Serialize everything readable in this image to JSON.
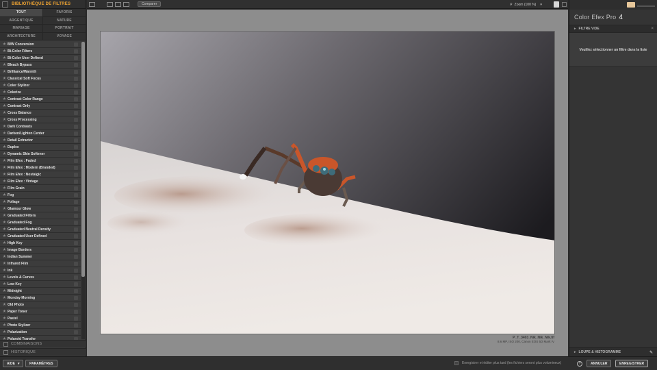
{
  "left_panel": {
    "title": "BIBLIOTHÈQUE DE FILTRES",
    "categories": [
      {
        "label": "TOUT",
        "active": true
      },
      {
        "label": "FAVORIS",
        "active": false
      },
      {
        "label": "ARGENTIQUE",
        "active": false
      },
      {
        "label": "NATURE",
        "active": false
      },
      {
        "label": "MARIAGE",
        "active": false
      },
      {
        "label": "PORTRAIT",
        "active": false
      },
      {
        "label": "ARCHITECTURE",
        "active": false
      },
      {
        "label": "VOYAGE",
        "active": false
      }
    ],
    "filters": [
      "B/W Conversion",
      "Bi-Color Filters",
      "Bi-Color User Defined",
      "Bleach Bypass",
      "Brilliance/Warmth",
      "Classical Soft Focus",
      "Color Stylizer",
      "Colorize",
      "Contrast Color Range",
      "Contrast Only",
      "Cross Balance",
      "Cross Processing",
      "Dark Contrasts",
      "Darken/Lighten Center",
      "Detail Extractor",
      "Duplex",
      "Dynamic Skin Softener",
      "Film Efex : Faded",
      "Film Efex : Modern (Branded)",
      "Film Efex : Nostalgic",
      "Film Efex : Vintage",
      "Film Grain",
      "Fog",
      "Foliage",
      "Glamour Glow",
      "Graduated Filters",
      "Graduated Fog",
      "Graduated Neutral Density",
      "Graduated User Defined",
      "High Key",
      "Image Borders",
      "Indian Summer",
      "Infrared Film",
      "Ink",
      "Levels & Curves",
      "Low Key",
      "Midnight",
      "Monday Morning",
      "Old Photo",
      "Paper Toner",
      "Pastel",
      "Photo Stylizer",
      "Polarization",
      "Polaroid Transfer"
    ],
    "scroll_fraction": 0.79,
    "combinations_label": "COMBINAISONS",
    "history_label": "HISTORIQUE"
  },
  "toolbar": {
    "compare_label": "Comparer",
    "zoom_label": "Zoom (100 %)"
  },
  "canvas": {
    "file_name": "P_T_3403_Nik_Nik_Nik.tif",
    "file_meta": "8.6 MP, ISO 200, Canon EOS 5D Mark IV"
  },
  "right_panel": {
    "product_name": "Color Efex Pro",
    "product_version": "4",
    "filter_section_label": "FILTRE VIDE",
    "empty_message": "Veuillez sélectionner un filtre dans la liste",
    "loupe_label": "LOUPE & HISTOGRAMME"
  },
  "bottom_bar": {
    "help_label": "AIDE",
    "settings_label": "PARAMÈTRES",
    "save_later_label": "Enregistrer et éditer plus tard (les fichiers seront plus volumineux)",
    "help_icon": "?",
    "cancel_label": "ANNULER",
    "save_label": "ENREGISTRER"
  },
  "icons": {
    "star": "★",
    "triangle": "▸",
    "close": "×",
    "pin": "✎",
    "chevron": "▾"
  },
  "colors": {
    "accent": "#f1a532"
  }
}
